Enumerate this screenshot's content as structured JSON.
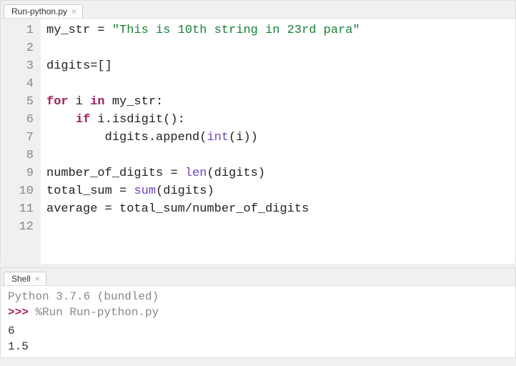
{
  "editor": {
    "tab": {
      "label": "Run-python.py"
    },
    "lines": [
      {
        "n": "1",
        "html": "my_str <span class='op'>=</span> <span class='str'>\"This is 10th string in 23rd para\"</span>"
      },
      {
        "n": "2",
        "html": ""
      },
      {
        "n": "3",
        "html": "digits<span class='op'>=</span>[]"
      },
      {
        "n": "4",
        "html": ""
      },
      {
        "n": "5",
        "html": "<span class='kw'>for</span> i <span class='kw'>in</span> my_str:"
      },
      {
        "n": "6",
        "html": "    <span class='kw2'>if</span> i.isdigit():"
      },
      {
        "n": "7",
        "html": "        digits.append(<span class='builtin'>int</span>(i))"
      },
      {
        "n": "8",
        "html": ""
      },
      {
        "n": "9",
        "html": "number_of_digits <span class='op'>=</span> <span class='builtin'>len</span>(digits)"
      },
      {
        "n": "10",
        "html": "total_sum <span class='op'>=</span> <span class='builtin'>sum</span>(digits)"
      },
      {
        "n": "11",
        "html": "average <span class='op'>=</span> total_sum<span class='op'>/</span>number_of_digits"
      },
      {
        "n": "12",
        "html": ""
      }
    ]
  },
  "shell": {
    "tab": {
      "label": "Shell"
    },
    "banner": "Python 3.7.6 (bundled)",
    "prompt_arrows": ">>>",
    "run_cmd": "%Run Run-python.py",
    "output": [
      "6",
      "1.5"
    ]
  }
}
